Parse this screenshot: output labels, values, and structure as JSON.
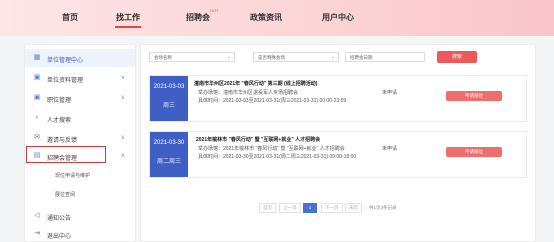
{
  "nav": {
    "items": [
      "首页",
      "找工作",
      "招聘会",
      "政策资讯",
      "用户中心"
    ],
    "hot_badge": "HOT"
  },
  "sidebar": {
    "items": [
      {
        "label": "单位管理中心",
        "icon": "building-icon"
      },
      {
        "label": "单位资料管理",
        "icon": "briefcase-icon"
      },
      {
        "label": "职位管理",
        "icon": "briefcase-icon"
      },
      {
        "label": "人才搜索",
        "icon": "search-icon"
      },
      {
        "label": "邀请与反馈",
        "icon": "mail-icon"
      },
      {
        "label": "招聘会管理",
        "icon": "calendar-icon"
      },
      {
        "label": "通知公告",
        "icon": "speaker-icon"
      },
      {
        "label": "退出中心",
        "icon": "exit-icon"
      }
    ],
    "sub_items": [
      "现位申请与维护",
      "展位查阅"
    ]
  },
  "filters": {
    "job_name_placeholder": "会场名称",
    "special_placeholder": "是否特殊会场",
    "date_placeholder": "招聘会日期",
    "search_label": "搜索"
  },
  "cards": [
    {
      "date": "2021-03-03",
      "weekday": "周三",
      "title": "潼南市华州区2021年 \"春风行动\" 第三期 (线上招聘活动)",
      "organizer": "举办场馆：潼南市华州区退役军人专场招聘会",
      "status": "未申请",
      "time": "具体时间：2021-03-03至2021-03-31(周三2021-03-31) 00:00-23:59",
      "apply_label": "申请展位"
    },
    {
      "date": "2021-03-30",
      "weekday": "周二周三",
      "title": "2021年榆林市 \"春风行动\" 暨 \"互联网+就业\" 人才招聘会",
      "organizer": "举办场馆：2021年榆林市 \"春风行动\" 暨 \"互联网+就业\" 人才招聘会",
      "status": "未申请",
      "time": "具体时间：2021-03-30至2021-03-31(周二周三2021-03-31) 09:00-18:00",
      "apply_label": "申请展位"
    }
  ],
  "pager": {
    "first": "首页",
    "prev": "上一页",
    "current": "1",
    "next": "下一页",
    "last": "末页",
    "info": "共1页2条记录"
  }
}
